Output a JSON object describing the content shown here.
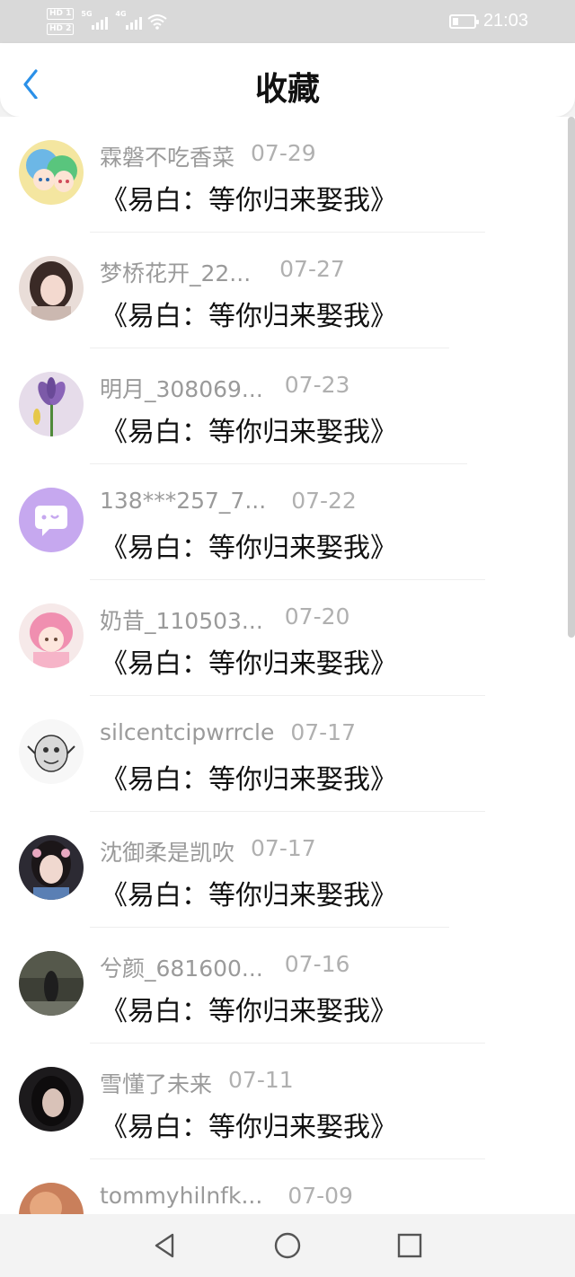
{
  "status_bar": {
    "sim1": "HD 1",
    "sim2": "HD 2",
    "net1": "5G",
    "net2": "4G",
    "time": "21:03",
    "icons": [
      "signal-icon",
      "wifi-icon",
      "battery-icon"
    ]
  },
  "header": {
    "title": "收藏",
    "back_icon": "chevron-left-icon",
    "accent_color": "#2a90e8"
  },
  "items": [
    {
      "user": "霖磐不吃香菜",
      "date": "07-29",
      "book": "《易白：等你归来娶我》",
      "avatar": "anime-pair"
    },
    {
      "user": "梦桥花开_22...",
      "date": "07-27",
      "book": "《易白：等你归来娶我》",
      "avatar": "photo-girl"
    },
    {
      "user": "明月_308069...",
      "date": "07-23",
      "book": "《易白：等你归来娶我》",
      "avatar": "iris-flower"
    },
    {
      "user": "138***257_7...",
      "date": "07-22",
      "book": "《易白：等你归来娶我》",
      "avatar": "default-chat"
    },
    {
      "user": "奶昔_110503...",
      "date": "07-20",
      "book": "《易白：等你归来娶我》",
      "avatar": "anime-pink"
    },
    {
      "user": "silcentcipwrrcle",
      "date": "07-17",
      "book": "《易白：等你归来娶我》",
      "avatar": "sketch"
    },
    {
      "user": "沈御柔是凯吹",
      "date": "07-17",
      "book": "《易白：等你归来娶我》",
      "avatar": "photo-dark"
    },
    {
      "user": "兮颜_681600...",
      "date": "07-16",
      "book": "《易白：等你归来娶我》",
      "avatar": "photo-street"
    },
    {
      "user": "雪懂了未来",
      "date": "07-11",
      "book": "《易白：等你归来娶我》",
      "avatar": "photo-portrait"
    },
    {
      "user": "tommyhilnfk...",
      "date": "07-09",
      "book": "",
      "avatar": "photo-warm"
    }
  ],
  "nav": {
    "back": "triangle-back-icon",
    "home": "circle-home-icon",
    "recent": "square-recent-icon"
  }
}
